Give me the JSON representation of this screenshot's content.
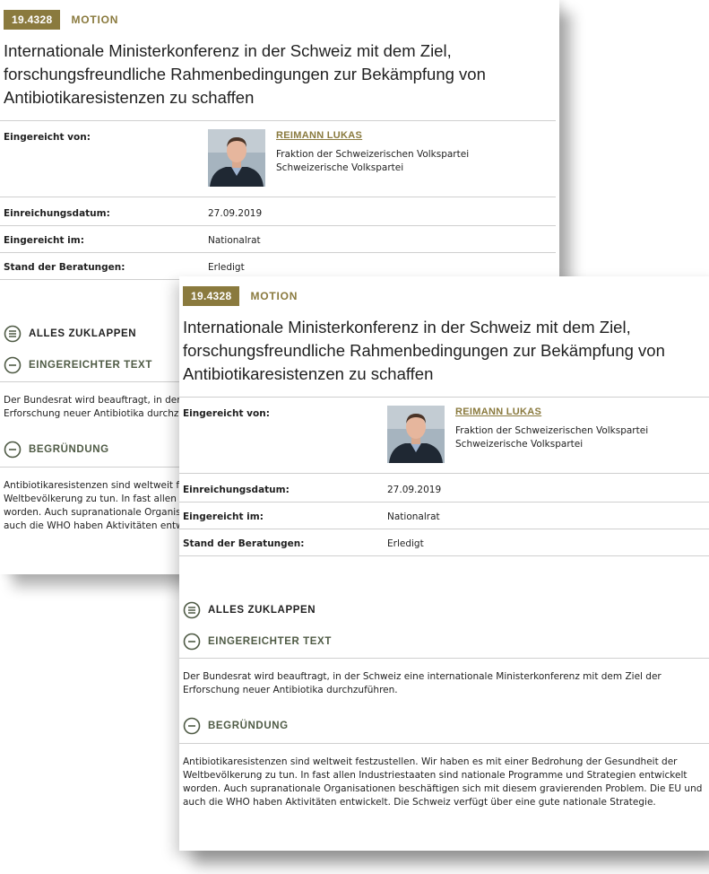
{
  "motion": {
    "number": "19.4328",
    "type": "MOTION",
    "title": "Internationale Ministerkonferenz in der Schweiz mit dem Ziel, forschungsfreundliche Rahmenbedingungen zur Bekämpfung von Antibiotikaresistenzen zu schaffen"
  },
  "details": {
    "submitted_by_label": "Eingereicht von:",
    "author_name": "REIMANN LUKAS",
    "faction": "Fraktion der Schweizerischen Volkspartei",
    "party": "Schweizerische Volkspartei",
    "date_label": "Einreichungsdatum:",
    "date_value": "27.09.2019",
    "council_label": "Eingereicht im:",
    "council_value": "Nationalrat",
    "status_label": "Stand der Beratungen:",
    "status_value": "Erledigt"
  },
  "sections": {
    "collapse_all": "ALLES ZUKLAPPEN",
    "submitted_text_heading": "EINGEREICHTER TEXT",
    "submitted_text": "Der Bundesrat wird beauftragt, in der Schweiz eine internationale Ministerkonferenz mit dem Ziel der Erforschung neuer Antibiotika durchzuführen.",
    "reasoning_heading": "BEGRÜNDUNG",
    "reasoning_text": "Antibiotikaresistenzen sind weltweit festzustellen. Wir haben es mit einer Bedrohung der Gesundheit der Weltbevölkerung zu tun. In fast allen Industriestaaten sind nationale Programme und Strategien entwickelt worden. Auch supranationale Organisationen beschäftigen sich mit diesem gravierenden Problem. Die EU und auch die WHO haben Aktivitäten entwickelt. Die Schweiz verfügt über eine gute nationale Strategie."
  },
  "icons": {
    "collapse_all": "list-circle-icon",
    "collapse_section": "minus-circle-icon",
    "avatar": "person-photo"
  },
  "colors": {
    "accent_olive": "#8a7a3e",
    "section_heading": "#4f5b45"
  }
}
